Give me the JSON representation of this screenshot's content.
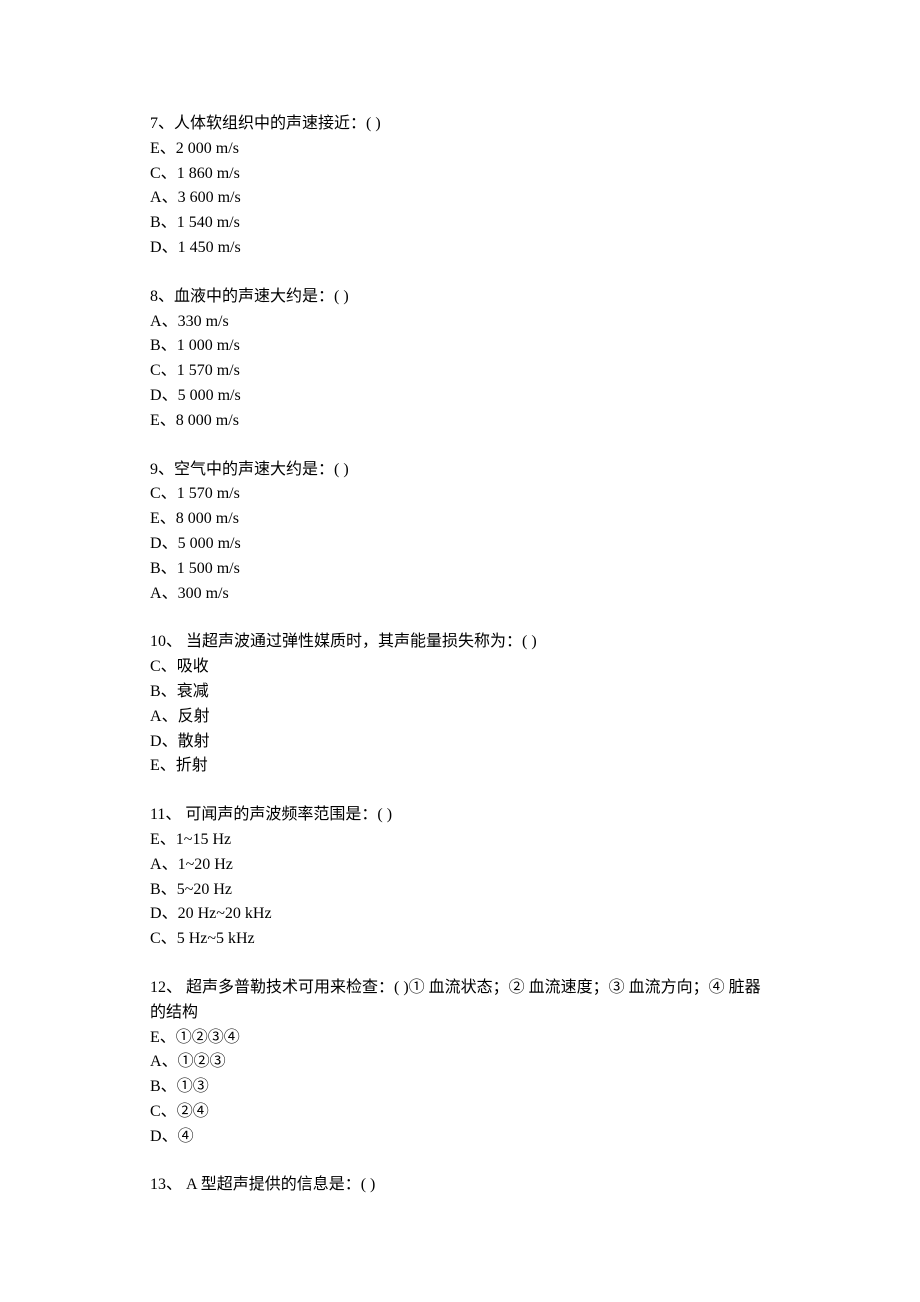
{
  "questions": [
    {
      "number": "7",
      "text": "人体软组织中的声速接近：( )",
      "options": [
        {
          "letter": "E",
          "text": "2 000 m/s"
        },
        {
          "letter": "C",
          "text": "1 860 m/s"
        },
        {
          "letter": "A",
          "text": "3 600 m/s"
        },
        {
          "letter": "B",
          "text": "1 540 m/s"
        },
        {
          "letter": "D",
          "text": "1 450 m/s"
        }
      ]
    },
    {
      "number": "8",
      "text": "血液中的声速大约是：( )",
      "options": [
        {
          "letter": "A",
          "text": "330 m/s"
        },
        {
          "letter": "B",
          "text": "1 000 m/s"
        },
        {
          "letter": "C",
          "text": "1 570 m/s"
        },
        {
          "letter": "D",
          "text": "5 000 m/s"
        },
        {
          "letter": "E",
          "text": "8 000 m/s"
        }
      ]
    },
    {
      "number": "9",
      "text": "空气中的声速大约是：( )",
      "options": [
        {
          "letter": "C",
          "text": "1 570 m/s"
        },
        {
          "letter": "E",
          "text": "8 000 m/s"
        },
        {
          "letter": "D",
          "text": "5 000 m/s"
        },
        {
          "letter": "B",
          "text": "1 500 m/s"
        },
        {
          "letter": "A",
          "text": "300 m/s"
        }
      ]
    },
    {
      "number": "10",
      "text": " 当超声波通过弹性媒质时，其声能量损失称为：( )",
      "options": [
        {
          "letter": "C",
          "text": "吸收"
        },
        {
          "letter": "B",
          "text": "衰减"
        },
        {
          "letter": "A",
          "text": "反射"
        },
        {
          "letter": "D",
          "text": "散射"
        },
        {
          "letter": "E",
          "text": "折射"
        }
      ]
    },
    {
      "number": "11",
      "text": " 可闻声的声波频率范围是：( )",
      "options": [
        {
          "letter": "E",
          "text": "1~15 Hz"
        },
        {
          "letter": "A",
          "text": "1~20 Hz"
        },
        {
          "letter": "B",
          "text": "5~20 Hz"
        },
        {
          "letter": "D",
          "text": "20 Hz~20 kHz"
        },
        {
          "letter": "C",
          "text": "5 Hz~5 kHz"
        }
      ]
    },
    {
      "number": "12",
      "text": " 超声多普勒技术可用来检查：( )① 血流状态；② 血流速度；③ 血流方向；④ 脏器的结构",
      "options": [
        {
          "letter": "E",
          "text": "①②③④"
        },
        {
          "letter": "A",
          "text": "①②③"
        },
        {
          "letter": "B",
          "text": "①③"
        },
        {
          "letter": "C",
          "text": "②④"
        },
        {
          "letter": "D",
          "text": "④"
        }
      ]
    },
    {
      "number": "13",
      "text": " A 型超声提供的信息是：( )",
      "options": []
    }
  ]
}
